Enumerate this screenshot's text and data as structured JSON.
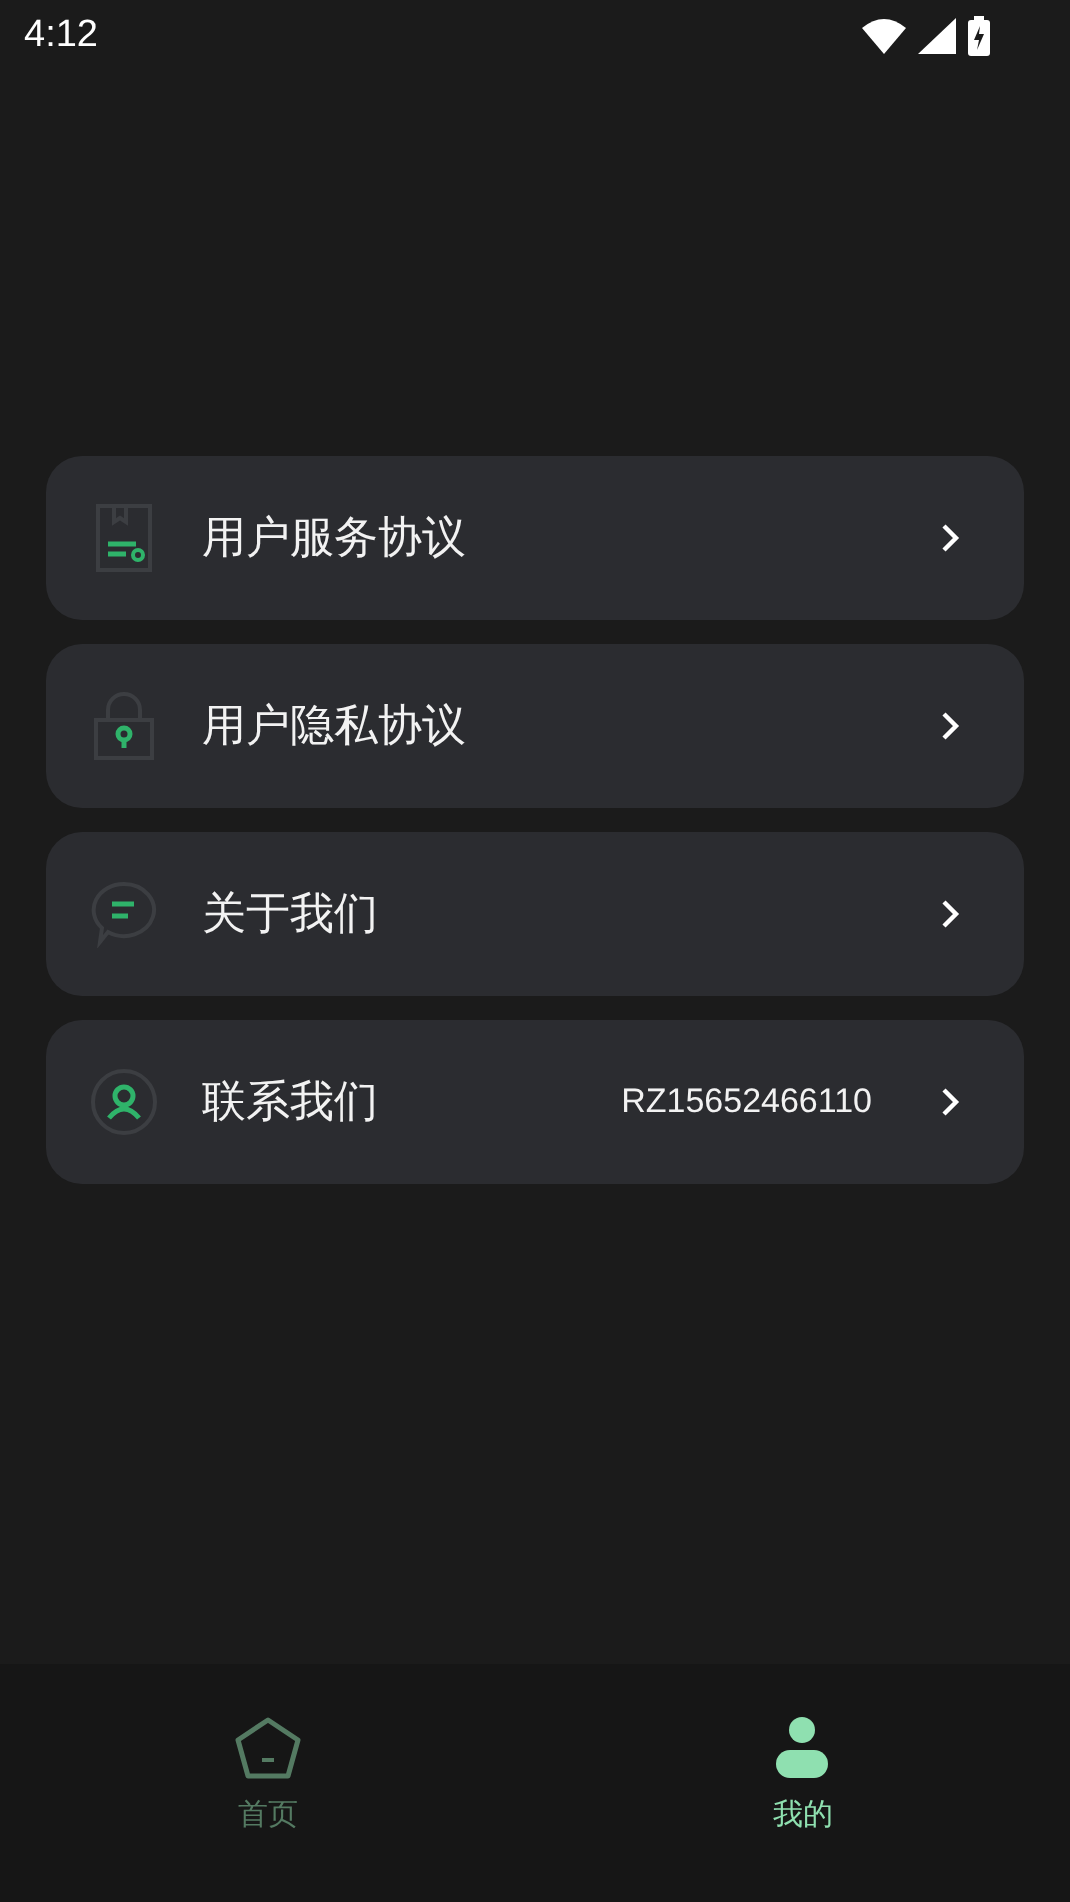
{
  "status_bar": {
    "time": "4:12"
  },
  "menu": [
    {
      "kind": "document",
      "label": "用户服务协议"
    },
    {
      "kind": "lock",
      "label": "用户隐私协议"
    },
    {
      "kind": "chat",
      "label": "关于我们"
    },
    {
      "kind": "person",
      "label": "联系我们",
      "value": "RZ15652466110"
    }
  ],
  "tabs": [
    {
      "kind": "home",
      "label": "首页",
      "selected": false
    },
    {
      "kind": "profile",
      "label": "我的",
      "selected": true
    }
  ]
}
